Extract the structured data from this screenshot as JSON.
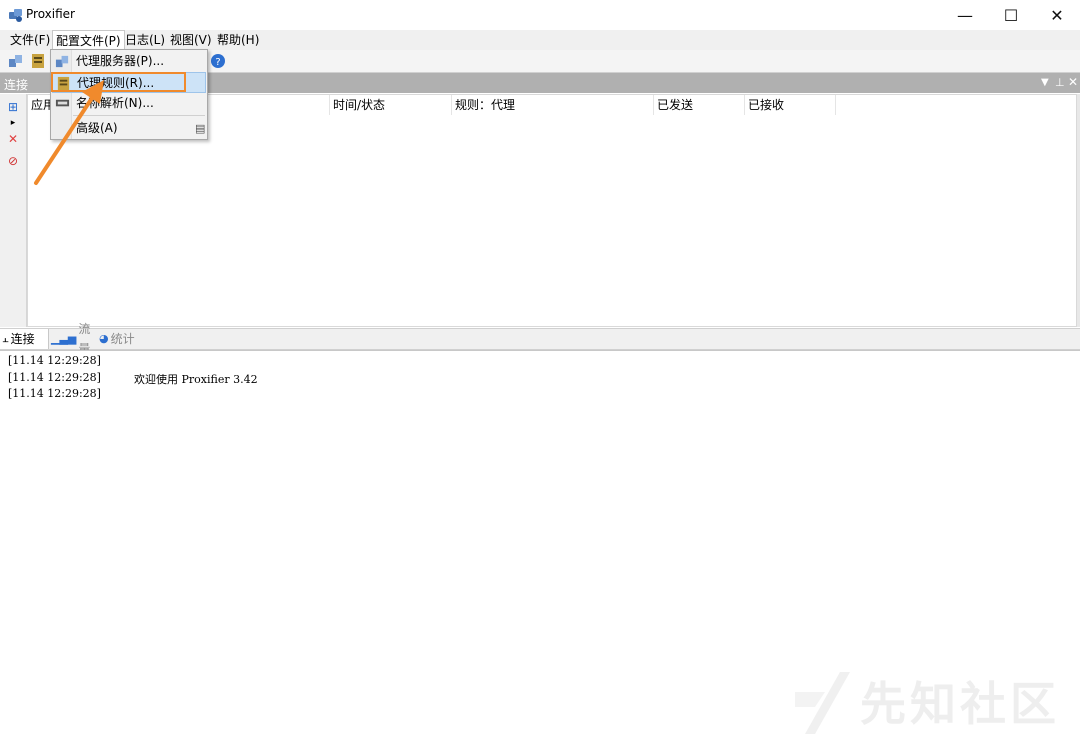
{
  "window": {
    "title": "Proxifier",
    "minimize": "—",
    "maximize": "☐",
    "close": "✕"
  },
  "menubar": {
    "items": [
      "文件(F)",
      "配置文件(P)",
      "日志(L)",
      "视图(V)",
      "帮助(H)"
    ]
  },
  "profile_menu": {
    "items": [
      {
        "label": "代理服务器(P)..."
      },
      {
        "label": "代理规则(R)..."
      },
      {
        "label": "名称解析(N)..."
      },
      {
        "label": "高级(A)"
      }
    ]
  },
  "connections_pane": {
    "title": "连接",
    "columns": [
      "应用",
      "时间/状态",
      "规则：代理",
      "已发送",
      "已接收"
    ]
  },
  "bottom_tabs": [
    "连接",
    "流量",
    "统计"
  ],
  "log": {
    "lines": [
      {
        "time": "[11.14 12:29:28]",
        "text": ""
      },
      {
        "time": "[11.14 12:29:28]",
        "text": "欢迎使用 Proxifier 3.42"
      },
      {
        "time": "[11.14 12:29:28]",
        "text": ""
      }
    ]
  },
  "watermark": "先知社区",
  "colors": {
    "annotation": "#f08a2c",
    "menu_highlight": "#cde3f7",
    "pane_header": "#b0b0b0"
  }
}
